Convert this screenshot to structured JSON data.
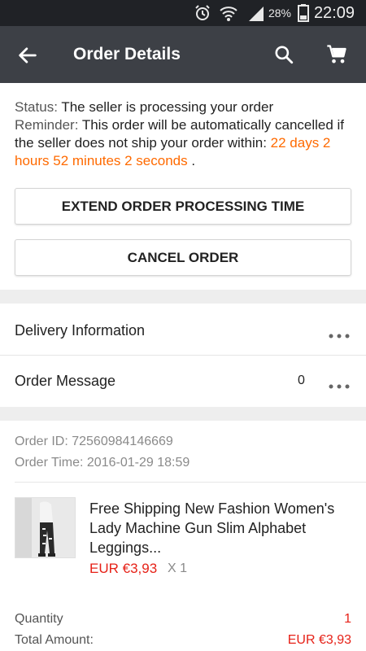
{
  "status_bar": {
    "battery": "28%",
    "time": "22:09",
    "icons": [
      "alarm-icon",
      "wifi-icon",
      "signal-icon",
      "battery-icon"
    ]
  },
  "app_bar": {
    "title": "Order Details",
    "icons": [
      "back-arrow-icon",
      "search-icon",
      "cart-icon"
    ]
  },
  "order_status": {
    "status_label": "Status:",
    "status_text": " The seller is processing your order",
    "reminder_label": "Reminder:",
    "reminder_text": " This order will be automatically cancelled if the seller does not ship your order within: ",
    "countdown": "22 days 2 hours 52 minutes 2 seconds",
    "trailing": " ."
  },
  "buttons": {
    "extend": "EXTEND ORDER PROCESSING TIME",
    "cancel": "CANCEL ORDER"
  },
  "sections": {
    "delivery": {
      "label": "Delivery Information"
    },
    "message": {
      "label": "Order Message",
      "count": "0"
    }
  },
  "order": {
    "id": "Order ID: 72560984146669",
    "time": "Order Time: 2016-01-29 18:59"
  },
  "product": {
    "title": "Free Shipping New Fashion Women's Lady Machine Gun Slim Alphabet Leggings...",
    "price": "EUR €3,93",
    "quantity": "X 1"
  },
  "summary": {
    "quantity_label": "Quantity",
    "quantity_value": "1",
    "total_label": "Total Amount:",
    "total_value": "EUR €3,93"
  },
  "colors": {
    "app_bar": "#3d4046",
    "status_bar": "#202226",
    "countdown": "#ff6a00",
    "price": "#e62117"
  }
}
